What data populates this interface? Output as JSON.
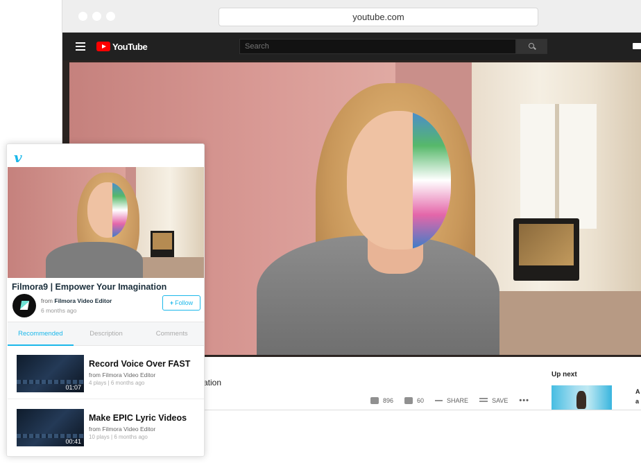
{
  "browser": {
    "url": "youtube.com"
  },
  "youtube": {
    "logo_text": "YouTube",
    "search_placeholder": "Search",
    "title_fragment": "ation",
    "actions": {
      "likes": "896",
      "dislikes": "60",
      "share": "SHARE",
      "save": "SAVE",
      "more": "•••"
    },
    "up_next": {
      "label": "Up next",
      "next_title_line1": "A",
      "next_title_line2": "a"
    }
  },
  "vimeo": {
    "logo": "v",
    "video_title": "Filmora9 | Empower Your Imagination",
    "from_label": "from",
    "channel": "Filmora Video Editor",
    "posted": "6 months ago",
    "follow_label": "Follow",
    "tabs": [
      "Recommended",
      "Description",
      "Comments"
    ],
    "active_tab": "Recommended",
    "recommended": [
      {
        "title": "Record Voice Over FAST",
        "from": "from Filmora Video Editor",
        "meta": "4 plays | 6 months ago",
        "duration": "01:07"
      },
      {
        "title": "Make EPIC Lyric Videos",
        "from": "from Filmora Video Editor",
        "meta": "10 plays | 6 months ago",
        "duration": "00:41"
      }
    ]
  },
  "colors": {
    "youtube_header": "#212121",
    "youtube_red": "#ff0000",
    "vimeo_blue": "#1ab7ea"
  }
}
